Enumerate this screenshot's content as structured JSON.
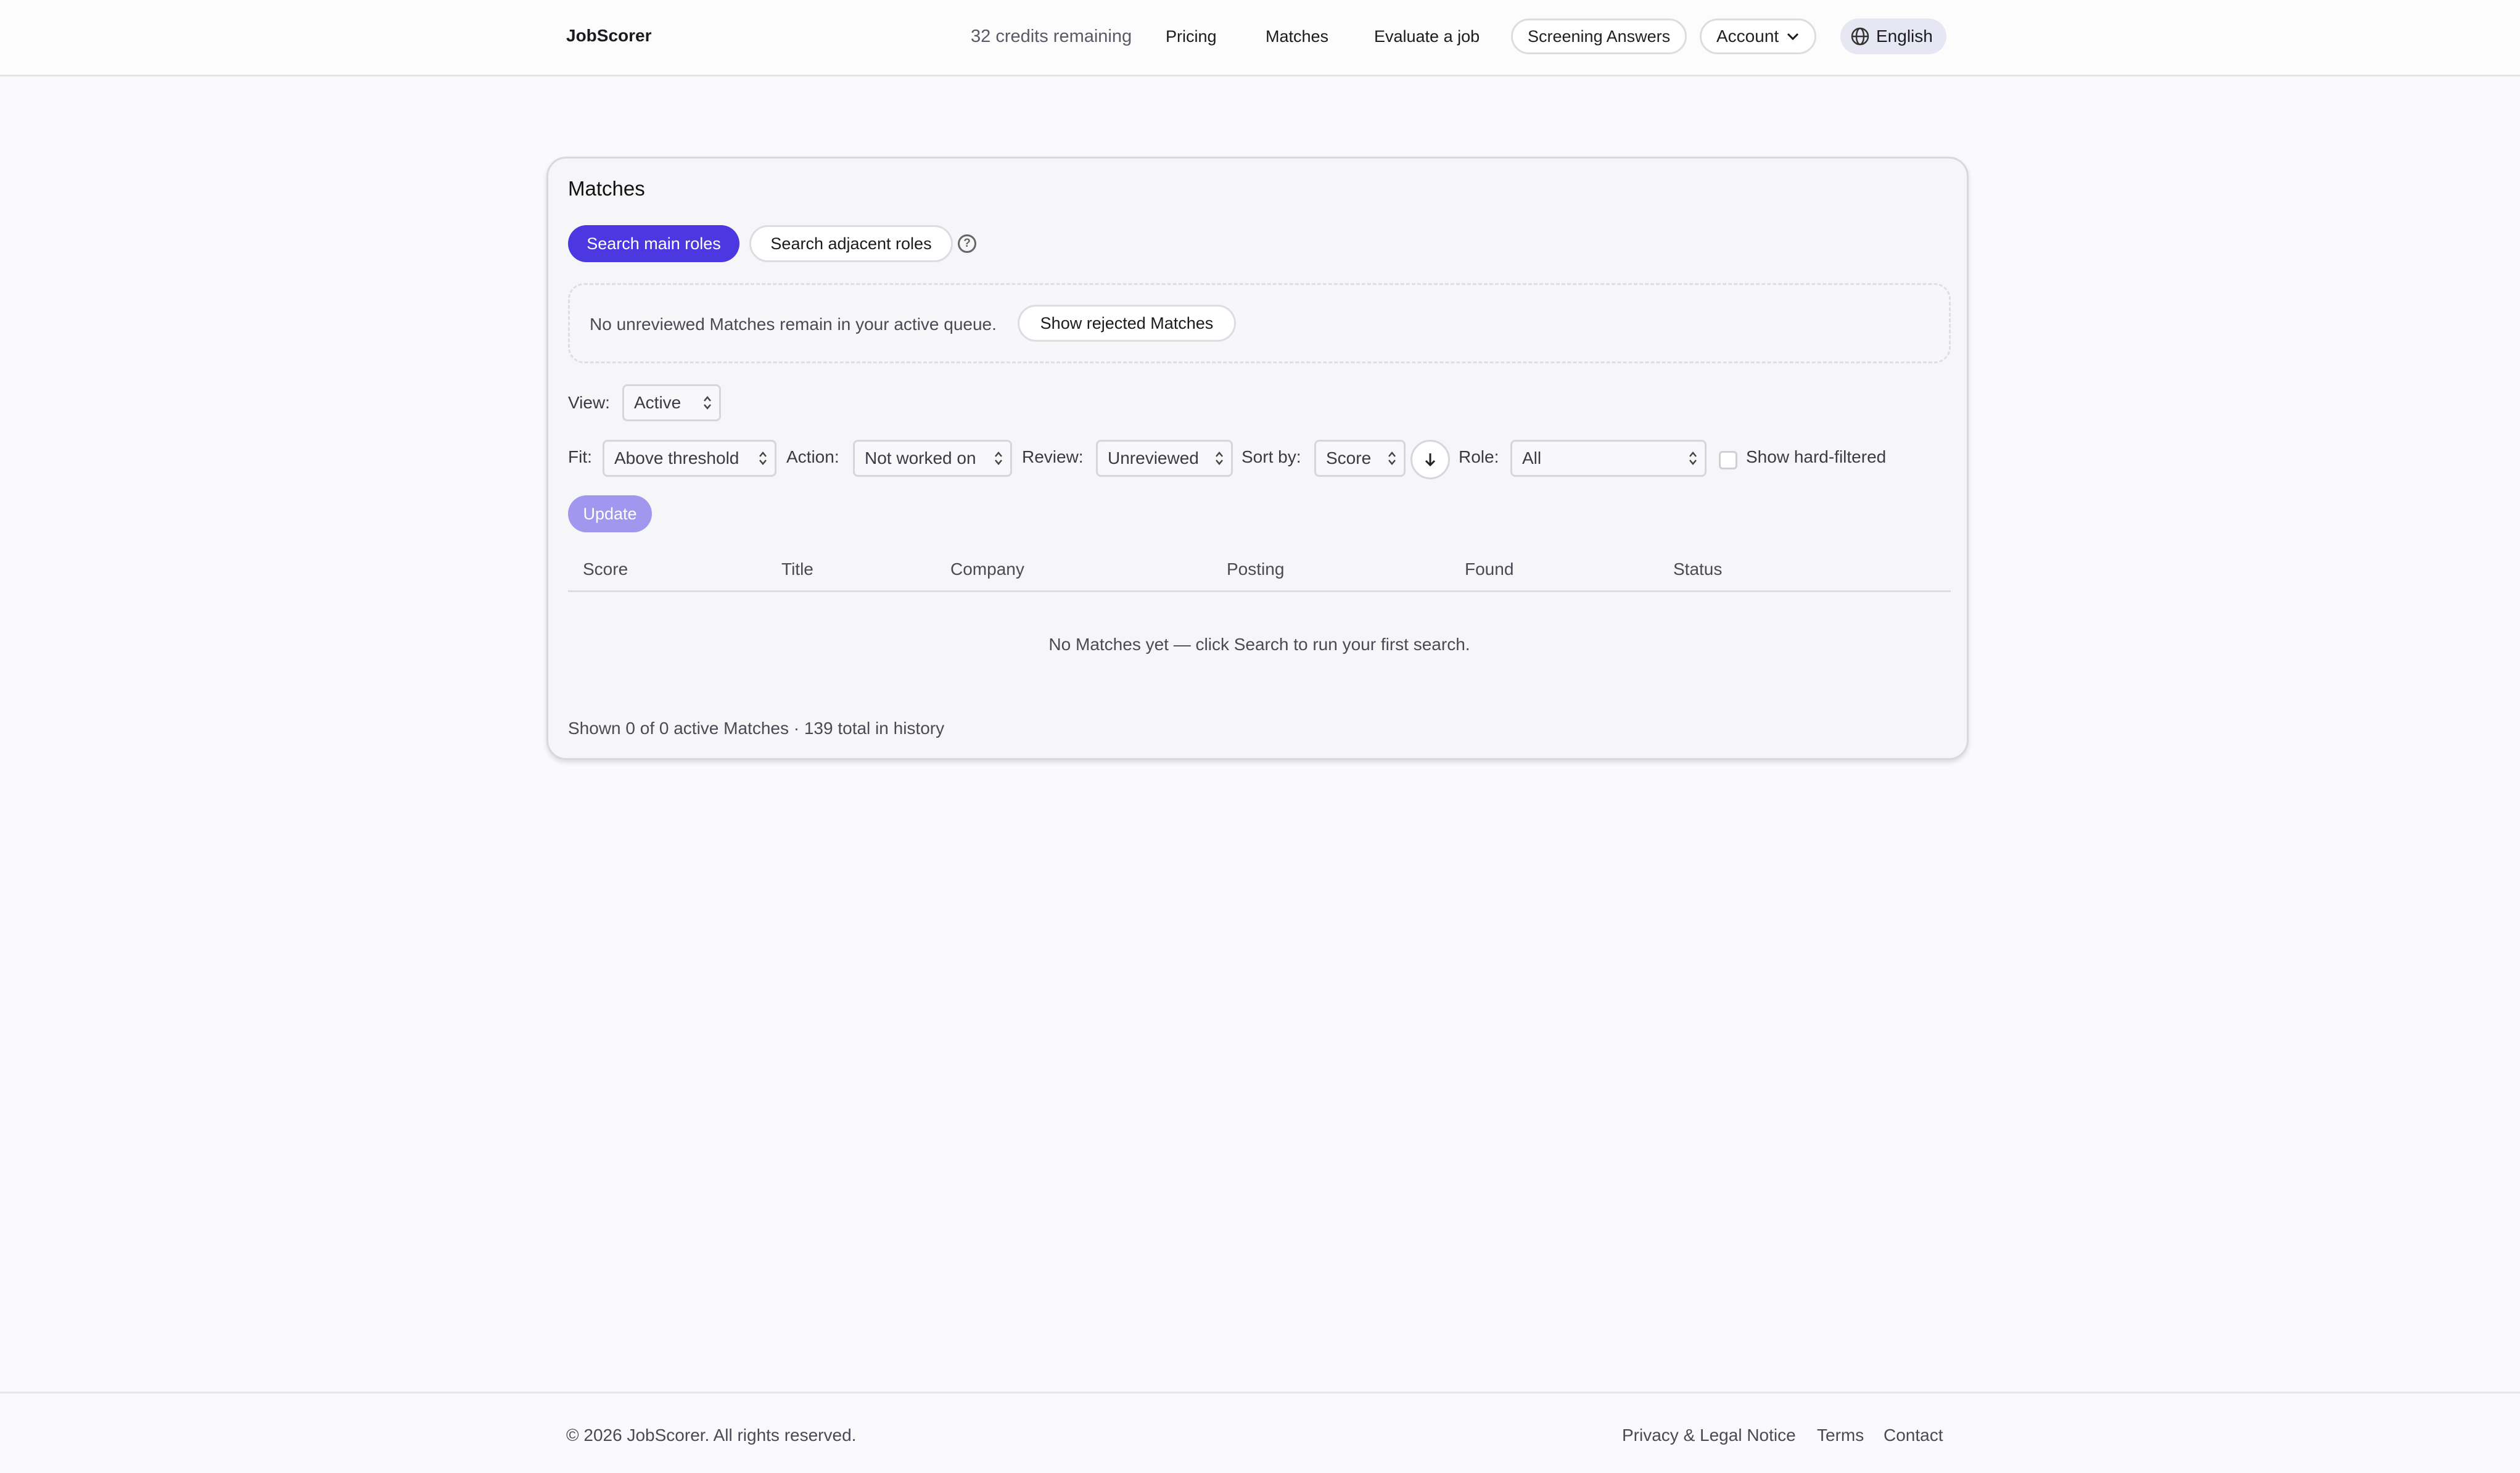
{
  "header": {
    "brand": "JobScorer",
    "credits": "32 credits remaining",
    "nav": {
      "pricing": "Pricing",
      "matches": "Matches",
      "evaluate": "Evaluate a job",
      "screening": "Screening Answers",
      "account": "Account",
      "language": "English"
    }
  },
  "card": {
    "title": "Matches",
    "tabs": {
      "main": "Search main roles",
      "adjacent": "Search adjacent roles"
    },
    "help": "?",
    "notice": {
      "text": "No unreviewed Matches remain in your active queue.",
      "button": "Show rejected Matches"
    },
    "filters": {
      "view_label": "View:",
      "view_value": "Active",
      "fit_label": "Fit:",
      "fit_value": "Above threshold",
      "action_label": "Action:",
      "action_value": "Not worked on",
      "review_label": "Review:",
      "review_value": "Unreviewed",
      "sort_label": "Sort by:",
      "sort_value": "Score",
      "role_label": "Role:",
      "role_value": "All",
      "hard_filtered_label": "Show hard-filtered",
      "hard_filtered_checked": false
    },
    "update_button": "Update",
    "table": {
      "columns": [
        "Score",
        "Title",
        "Company",
        "Posting",
        "Found",
        "Status"
      ],
      "empty_message": "No Matches yet — click Search to run your first search."
    },
    "summary": "Shown 0 of 0 active Matches · 139 total in history"
  },
  "footer": {
    "copyright": "© 2026 JobScorer. All rights reserved.",
    "links": {
      "privacy": "Privacy & Legal Notice",
      "terms": "Terms",
      "contact": "Contact"
    }
  },
  "colors": {
    "accent": "#4b38e0",
    "accent_disabled": "#a197ef",
    "background": "#fafafc",
    "card_bg": "#f6f6f9"
  },
  "icons": {
    "account_caret": "chevron-down-icon",
    "language": "globe-icon",
    "help": "question-circle-icon",
    "select_caret": "updown-chevron-icon",
    "sort_direction": "arrow-down-icon"
  }
}
